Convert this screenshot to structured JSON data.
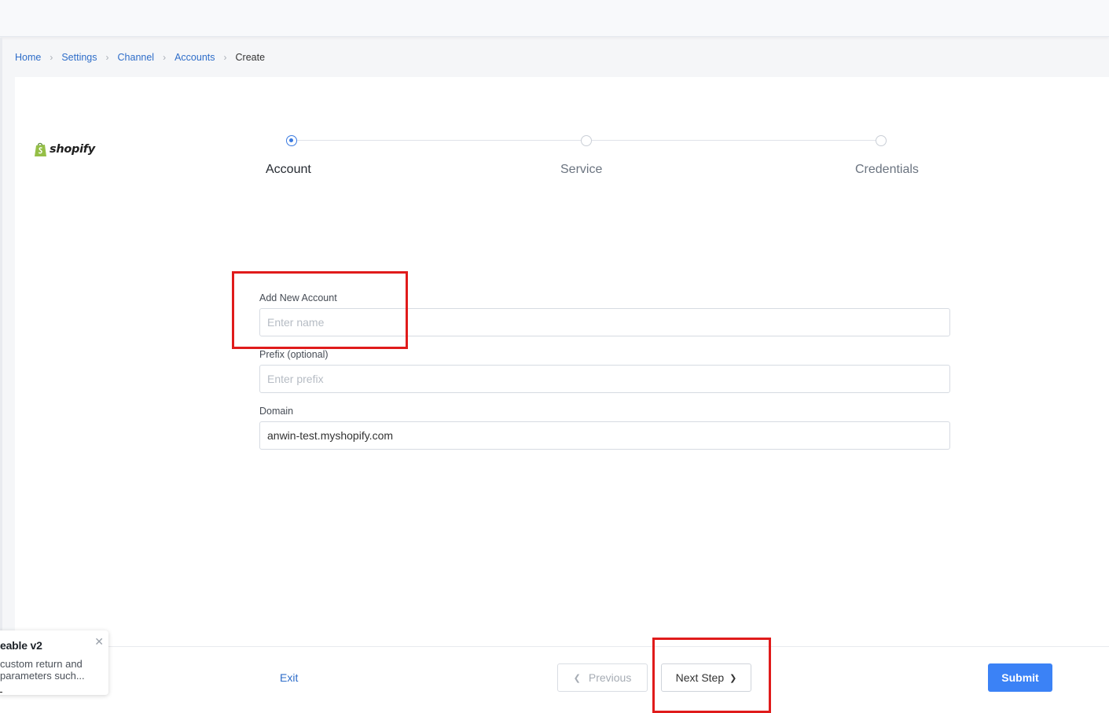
{
  "breadcrumb": {
    "items": [
      {
        "label": "Home"
      },
      {
        "label": "Settings"
      },
      {
        "label": "Channel"
      },
      {
        "label": "Accounts"
      }
    ],
    "current": "Create",
    "separator": ">"
  },
  "logo": {
    "text": "shopify",
    "icon": "shopify-bag-icon",
    "color": "#95bf47"
  },
  "stepper": {
    "steps": [
      {
        "label": "Account",
        "state": "active"
      },
      {
        "label": "Service",
        "state": "inactive"
      },
      {
        "label": "Credentials",
        "state": "inactive"
      }
    ],
    "accent": "#3a7ae0"
  },
  "form": {
    "account": {
      "label": "Add New Account",
      "placeholder": "Enter name",
      "value": ""
    },
    "prefix": {
      "label": "Prefix (optional)",
      "placeholder": "Enter prefix",
      "value": ""
    },
    "domain": {
      "label": "Domain",
      "placeholder": "",
      "value": "anwin-test.myshopify.com"
    }
  },
  "footer": {
    "exit_label": "Exit",
    "previous_label": "Previous",
    "next_label": "Next Step",
    "submit_label": "Submit",
    "submit_color": "#3b82f6"
  },
  "toast": {
    "title": "eable v2",
    "body": "custom return and parameters such..."
  },
  "annotation_color": "#e01b1b"
}
